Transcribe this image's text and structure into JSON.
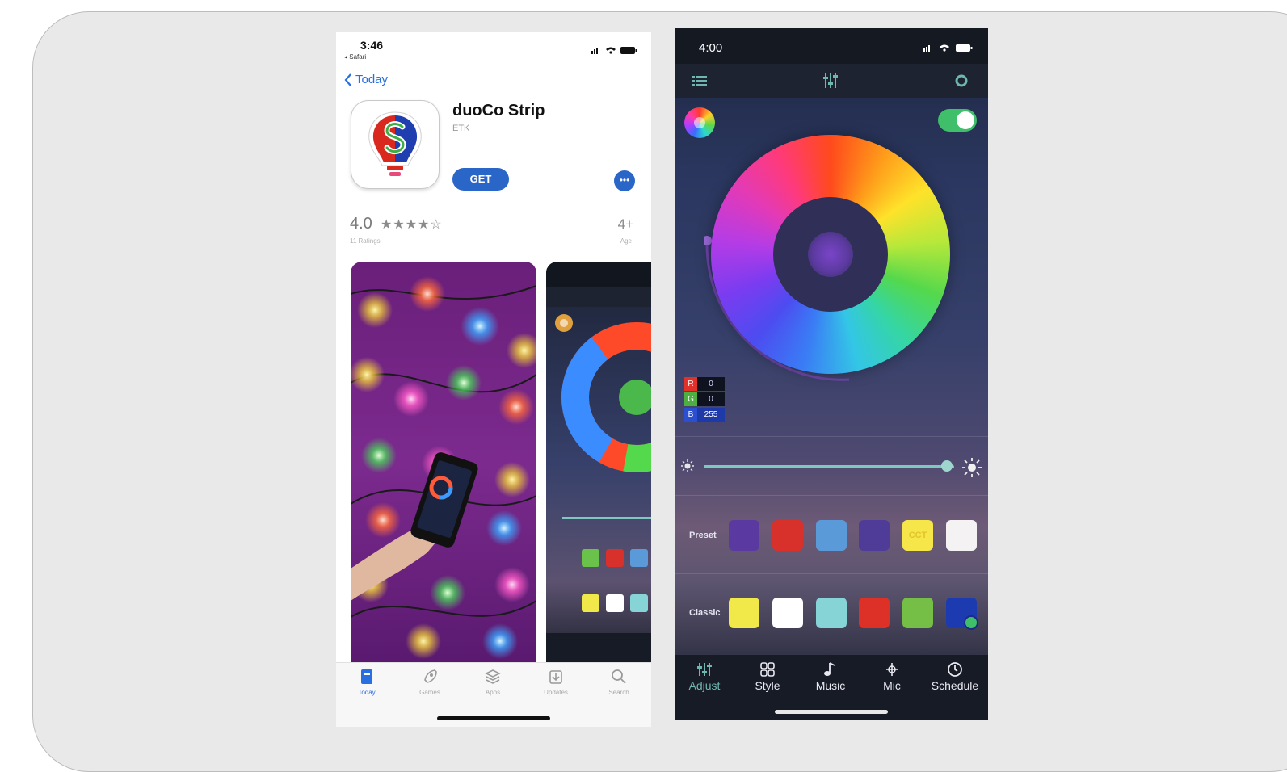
{
  "appstore": {
    "status_time": "3:46",
    "status_back": "◂ Safari",
    "back_label": "Today",
    "app_name": "duoCo Strip",
    "developer": "ETK",
    "get_label": "GET",
    "more_label": "•••",
    "rating": "4.0",
    "stars": "★★★★☆",
    "ratings_count": "11 Ratings",
    "age": "4+",
    "age_label": "Age",
    "tabs": [
      {
        "label": "Today",
        "icon": "today-icon"
      },
      {
        "label": "Games",
        "icon": "rocket-icon"
      },
      {
        "label": "Apps",
        "icon": "stack-icon"
      },
      {
        "label": "Updates",
        "icon": "download-icon"
      },
      {
        "label": "Search",
        "icon": "search-icon"
      }
    ],
    "colors": {
      "accent": "#2a66c8"
    }
  },
  "controller": {
    "status_time": "4:00",
    "rgb": [
      {
        "tag": "R",
        "value": "0",
        "color": "#e0312a"
      },
      {
        "tag": "G",
        "value": "0",
        "color": "#4caf3f"
      },
      {
        "tag": "B",
        "value": "255",
        "color": "#2a4fd0"
      }
    ],
    "brightness": 0.97,
    "preset_label": "Preset",
    "preset_swatches": [
      {
        "color": "#5a3aa0",
        "text": ""
      },
      {
        "color": "#d8302a",
        "text": ""
      },
      {
        "color": "#5b9ad8",
        "text": ""
      },
      {
        "color": "#4e3c98",
        "text": ""
      },
      {
        "color": "#f6e64a",
        "text": "CCT"
      },
      {
        "color": "#f4f2f2",
        "text": ""
      }
    ],
    "classic_label": "Classic",
    "classic_swatches": [
      {
        "color": "#f1e84a",
        "selected": false
      },
      {
        "color": "#ffffff",
        "selected": false
      },
      {
        "color": "#86d4d6",
        "selected": false
      },
      {
        "color": "#dd3026",
        "selected": false
      },
      {
        "color": "#76bf46",
        "selected": false
      },
      {
        "color": "#1c3bb0",
        "selected": true
      }
    ],
    "tabs": [
      {
        "label": "Adjust",
        "icon": "sliders-icon"
      },
      {
        "label": "Style",
        "icon": "grid-icon"
      },
      {
        "label": "Music",
        "icon": "note-icon"
      },
      {
        "label": "Mic",
        "icon": "mic-icon"
      },
      {
        "label": "Schedule",
        "icon": "clock-icon"
      }
    ],
    "colors": {
      "accent": "#3fbf6a",
      "slider": "#7fc7c1"
    }
  }
}
